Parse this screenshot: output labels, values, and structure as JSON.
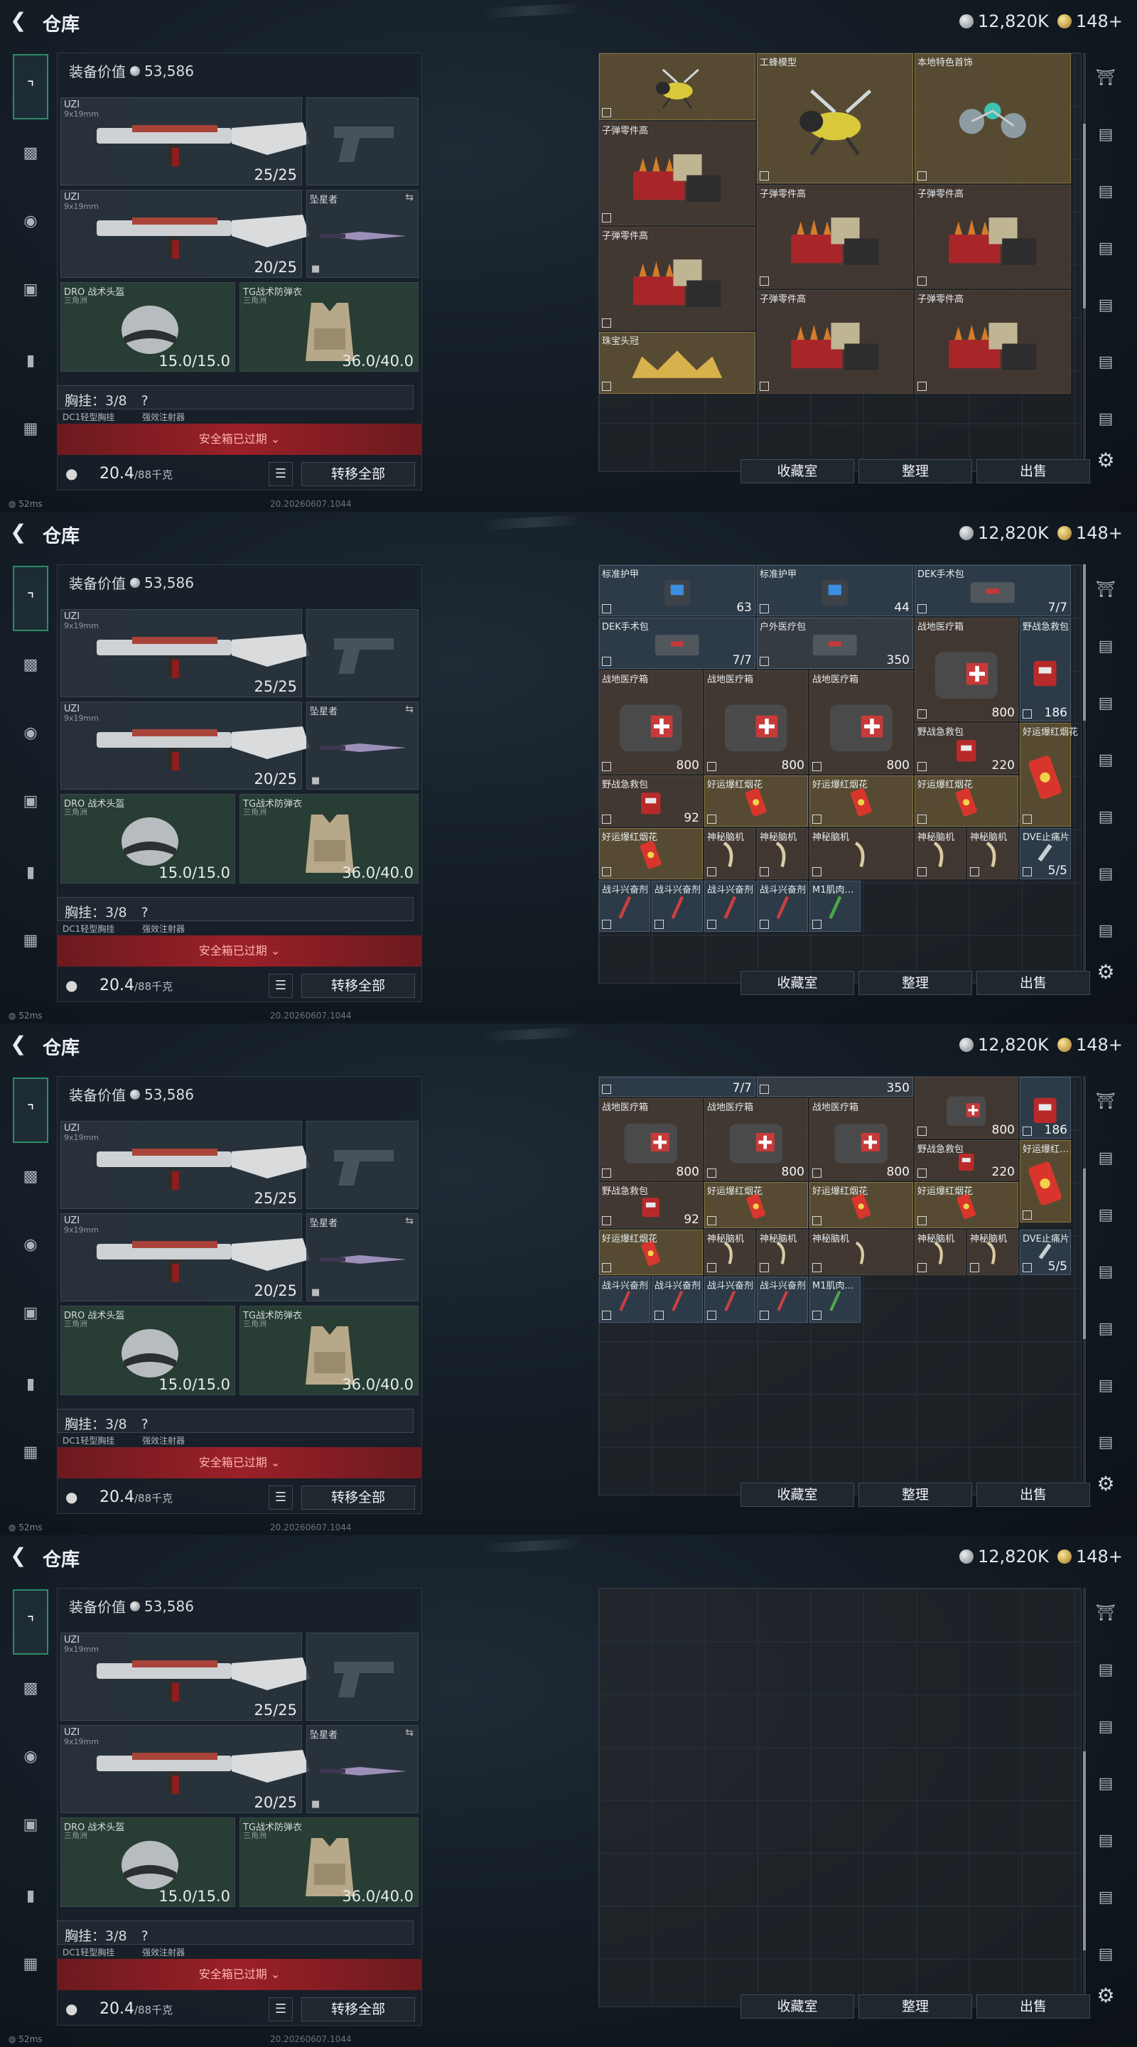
{
  "app": {
    "title": "仓库",
    "silver": "12,820K",
    "gold": "148+"
  },
  "equipment": {
    "value_label": "装备价值",
    "value": "53,586",
    "weapon1": {
      "name": "UZI",
      "sub": "9x19mm",
      "ammo": "25/25"
    },
    "weapon2": {
      "name": "UZI",
      "sub": "9x19mm",
      "ammo": "20/25"
    },
    "melee": {
      "name": "坠星者"
    },
    "helmet": {
      "name": "DRO 战术头盔",
      "sub": "三角洲",
      "durability": "15.0/15.0"
    },
    "armor": {
      "name": "TG战术防弹衣",
      "sub": "三角洲",
      "durability": "36.0/40.0"
    },
    "rig": {
      "label": "胸挂",
      "capacity": "3/8",
      "help": "?"
    },
    "rig_items": [
      "DC1轻型胸挂",
      "强效注射器"
    ],
    "warning": "安全箱已过期",
    "weight": "20.4",
    "weight_max": "/88千克",
    "transfer_all": "转移全部"
  },
  "buttons": {
    "collection": "收藏室",
    "arrange": "整理",
    "sell": "出售"
  },
  "status": {
    "ping": "52ms",
    "stamp": "20.20260607.1044"
  },
  "frame1_items": [
    {
      "name": "",
      "count": ""
    },
    {
      "name": "工蜂模型",
      "count": ""
    },
    {
      "name": "本地特色首饰",
      "count": ""
    },
    {
      "name": "子弹零件高",
      "count": ""
    },
    {
      "name": "子弹零件高",
      "count": ""
    },
    {
      "name": "子弹零件高",
      "count": ""
    },
    {
      "name": "子弹零件高",
      "count": ""
    },
    {
      "name": "子弹零件高",
      "count": ""
    },
    {
      "name": "子弹零件高",
      "count": ""
    },
    {
      "name": "珠宝头冠",
      "count": ""
    }
  ],
  "frame2_items": [
    {
      "name": "标准护甲",
      "count": "63"
    },
    {
      "name": "标准护甲",
      "count": "44"
    },
    {
      "name": "DEK手术包",
      "count": "7/7"
    },
    {
      "name": "DEK手术包",
      "count": "7/7"
    },
    {
      "name": "户外医疗包",
      "count": "350"
    },
    {
      "name": "战地医疗箱",
      "count": "800"
    },
    {
      "name": "野战急救包",
      "count": "186"
    },
    {
      "name": "战地医疗箱",
      "count": "800"
    },
    {
      "name": "战地医疗箱",
      "count": "800"
    },
    {
      "name": "战地医疗箱",
      "count": "800"
    },
    {
      "name": "野战急救包",
      "count": "220"
    },
    {
      "name": "好运爆红烟花",
      "count": ""
    },
    {
      "name": "野战急救包",
      "count": "92"
    },
    {
      "name": "好运爆红烟花",
      "count": ""
    },
    {
      "name": "好运爆红烟花",
      "count": ""
    },
    {
      "name": "好运爆红烟花",
      "count": ""
    },
    {
      "name": "好运爆红烟花",
      "count": ""
    },
    {
      "name": "神秘脑机",
      "count": ""
    },
    {
      "name": "神秘脑机",
      "count": ""
    },
    {
      "name": "神秘脑机",
      "count": ""
    },
    {
      "name": "神秘脑机",
      "count": ""
    },
    {
      "name": "神秘脑机",
      "count": ""
    },
    {
      "name": "DVE止痛片",
      "count": "5/5"
    },
    {
      "name": "战斗兴奋剂",
      "count": ""
    },
    {
      "name": "战斗兴奋剂",
      "count": ""
    },
    {
      "name": "战斗兴奋剂",
      "count": ""
    },
    {
      "name": "战斗兴奋剂",
      "count": ""
    },
    {
      "name": "M1肌肉…",
      "count": ""
    }
  ],
  "frame3_items": [
    {
      "name": "",
      "count": "7/7"
    },
    {
      "name": "",
      "count": "350"
    },
    {
      "name": "",
      "count": "800"
    },
    {
      "name": "",
      "count": "186"
    },
    {
      "name": "战地医疗箱",
      "count": "800"
    },
    {
      "name": "战地医疗箱",
      "count": "800"
    },
    {
      "name": "战地医疗箱",
      "count": "800"
    },
    {
      "name": "野战急救包",
      "count": "220"
    },
    {
      "name": "好运爆红…",
      "count": ""
    },
    {
      "name": "野战急救包",
      "count": "92"
    },
    {
      "name": "好运爆红烟花",
      "count": ""
    },
    {
      "name": "好运爆红烟花",
      "count": ""
    },
    {
      "name": "好运爆红烟花",
      "count": ""
    },
    {
      "name": "好运爆红烟花",
      "count": ""
    },
    {
      "name": "神秘脑机",
      "count": ""
    },
    {
      "name": "神秘脑机",
      "count": ""
    },
    {
      "name": "神秘脑机",
      "count": ""
    },
    {
      "name": "神秘脑机",
      "count": ""
    },
    {
      "name": "神秘脑机",
      "count": ""
    },
    {
      "name": "DVE止痛片",
      "count": "5/5"
    },
    {
      "name": "战斗兴奋剂",
      "count": ""
    },
    {
      "name": "战斗兴奋剂",
      "count": ""
    },
    {
      "name": "战斗兴奋剂",
      "count": ""
    },
    {
      "name": "战斗兴奋剂",
      "count": ""
    },
    {
      "name": "M1肌肉…",
      "count": ""
    }
  ]
}
